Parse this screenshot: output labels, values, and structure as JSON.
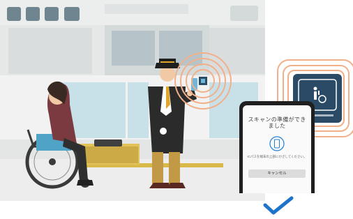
{
  "phone": {
    "title": "スキャンの準備ができました",
    "message": "ICパスを端末の上部にかざしてください。",
    "cancel_label": "キャンセル",
    "accent_color": "#1e7fd6"
  },
  "nfc_card": {
    "icon": "wheelchair-accessibility-icon"
  },
  "status": {
    "icon": "check-icon",
    "color": "#1e74c8"
  },
  "scene": {
    "nfc_wave_color": "#f1b08a",
    "card_color": "#2b4a66",
    "floor_color": "#ededed"
  }
}
